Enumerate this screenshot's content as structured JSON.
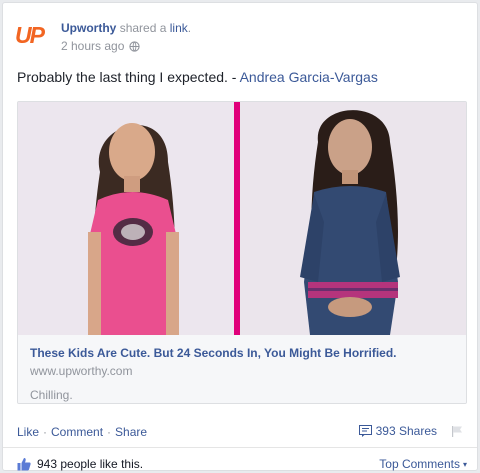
{
  "post": {
    "page_name": "Upworthy",
    "shared_text": "shared a",
    "shared_link_word": "link",
    "shared_suffix": ".",
    "timestamp": "2 hours ago",
    "logo_text": "UP",
    "message_text": "Probably the last thing I expected. - ",
    "message_author": "Andrea Garcia-Vargas"
  },
  "attachment": {
    "title": "These Kids Are Cute. But 24 Seconds In, You Might Be Horrified.",
    "domain": "www.upworthy.com",
    "description": "Chilling."
  },
  "actions": {
    "like": "Like",
    "comment": "Comment",
    "share": "Share",
    "separator": "·",
    "shares_count": "393 Shares"
  },
  "likes": {
    "text": "943 people like this.",
    "top_comments": "Top Comments",
    "caret": "▾"
  },
  "colors": {
    "brand_orange": "#f26522",
    "link_blue": "#3b5998",
    "divider_pink": "#e0007a"
  }
}
